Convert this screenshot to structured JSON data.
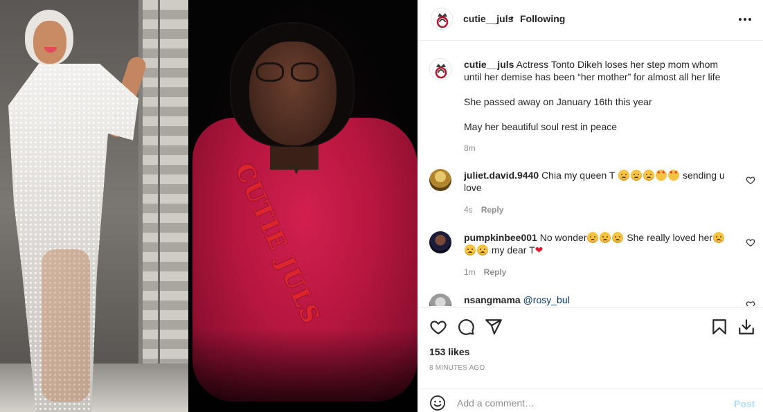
{
  "post": {
    "username": "cutie__juls",
    "separator": "•",
    "follow_status": "Following",
    "watermark": "CUTIE JULS",
    "caption": {
      "username": "cutie__juls",
      "line1": "Actress Tonto Dikeh loses her step mom whom until her demise has been “her mother” for almost all her life",
      "line2": "She passed away on January 16th this year",
      "line3": "May her beautiful soul rest in peace",
      "age": "8m"
    },
    "likes": "153 likes",
    "timestamp": "8 MINUTES AGO"
  },
  "comments": [
    {
      "username": "juliet.david.9440",
      "text_before": "Chia my queen T",
      "text_after": "sending u love",
      "age": "4s",
      "reply_label": "Reply",
      "emojis": [
        "sad-face",
        "sad-face",
        "sad-face",
        "star-struck",
        "star-struck"
      ]
    },
    {
      "username": "pumpkinbee001",
      "text_before": "No wonder",
      "text_middle": "She really loved her",
      "text_after": "my dear T",
      "age": "1m",
      "reply_label": "Reply",
      "emojis": [
        "sad-face",
        "sad-face",
        "sad-face",
        "sad-face",
        "sad-face",
        "sad-face",
        "red-heart"
      ]
    },
    {
      "username": "nsangmama",
      "text": "@rosy_bul"
    }
  ],
  "add_comment": {
    "placeholder": "Add a comment…",
    "post_label": "Post"
  },
  "colors": {
    "text": "#262626",
    "secondary": "#8e8e8e",
    "border": "#efefef",
    "post_disabled": "#b2dffc",
    "mention": "#00376b"
  },
  "icons": [
    "more-icon",
    "heart-icon",
    "comment-icon",
    "share-icon",
    "bookmark-icon",
    "download-icon",
    "emoji-icon"
  ]
}
